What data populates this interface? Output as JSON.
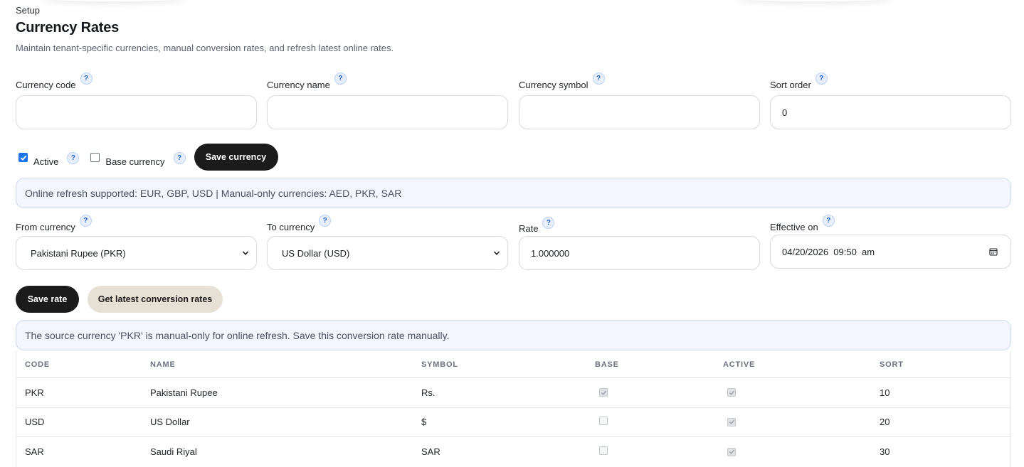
{
  "header": {
    "eyebrow": "Setup",
    "title": "Currency Rates",
    "subtitle": "Maintain tenant-specific currencies, manual conversion rates, and refresh latest online rates."
  },
  "currency_form": {
    "code": {
      "label": "Currency code",
      "value": ""
    },
    "name": {
      "label": "Currency name",
      "value": ""
    },
    "symbol": {
      "label": "Currency symbol",
      "value": ""
    },
    "sort": {
      "label": "Sort order",
      "value": "0"
    },
    "active": {
      "label": "Active",
      "checked": true
    },
    "base": {
      "label": "Base currency",
      "checked": false
    },
    "save_label": "Save currency"
  },
  "refresh_info": "Online refresh supported: EUR, GBP, USD | Manual-only currencies: AED, PKR, SAR",
  "rate_form": {
    "from": {
      "label": "From currency",
      "value": "Pakistani Rupee (PKR)"
    },
    "to": {
      "label": "To currency",
      "value": "US Dollar (USD)"
    },
    "rate": {
      "label": "Rate",
      "value": "1.000000"
    },
    "effective": {
      "label": "Effective on",
      "value": "04/20/2026  09:50  am"
    },
    "save_label": "Save rate",
    "latest_label": "Get latest conversion rates"
  },
  "rate_notice": "The source currency 'PKR' is manual-only for online refresh. Save this conversion rate manually.",
  "help_glyph": "?",
  "table": {
    "columns": [
      "CODE",
      "NAME",
      "SYMBOL",
      "BASE",
      "ACTIVE",
      "SORT"
    ],
    "rows": [
      {
        "code": "PKR",
        "name": "Pakistani Rupee",
        "symbol": "Rs.",
        "base": true,
        "active": true,
        "sort": "10"
      },
      {
        "code": "USD",
        "name": "US Dollar",
        "symbol": "$",
        "base": false,
        "active": true,
        "sort": "20"
      },
      {
        "code": "SAR",
        "name": "Saudi Riyal",
        "symbol": "SAR",
        "base": false,
        "active": true,
        "sort": "30"
      }
    ]
  },
  "colors": {
    "primary_button": "#1b1b1b",
    "secondary_button": "#e7e0d4",
    "info_bg": "#f3f6fe",
    "checkbox_accent": "#1a73e8"
  }
}
